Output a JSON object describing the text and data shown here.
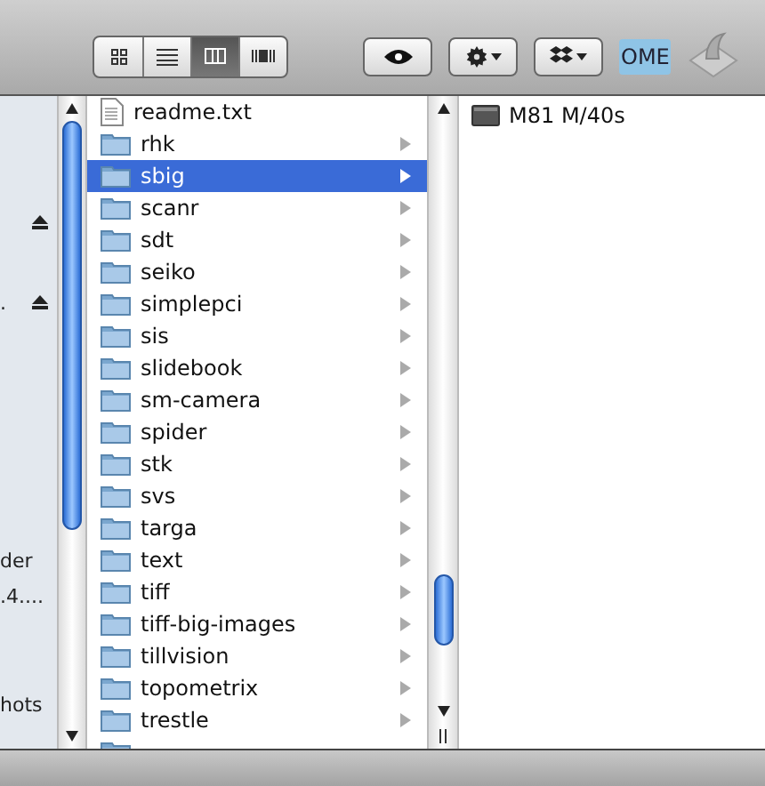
{
  "toolbar": {
    "view_modes": [
      {
        "kind": "icons",
        "selected": false
      },
      {
        "kind": "list",
        "selected": false
      },
      {
        "kind": "columns",
        "selected": true
      },
      {
        "kind": "coverflow",
        "selected": false
      }
    ],
    "buttons": [
      {
        "kind": "quicklook"
      },
      {
        "kind": "action"
      },
      {
        "kind": "dropbox"
      }
    ],
    "ome_label": "OME"
  },
  "sidebar": {
    "items": [
      {
        "eject": true
      },
      {
        "label": ".",
        "eject": true
      },
      {
        "label": "der",
        "eject": false
      },
      {
        "label": ".4....",
        "eject": false
      },
      {
        "label": "hots",
        "eject": false
      }
    ]
  },
  "columns": [
    {
      "items": [
        {
          "name": "readme.txt",
          "kind": "file",
          "selected": false
        },
        {
          "name": "rhk",
          "kind": "folder",
          "selected": false
        },
        {
          "name": "sbig",
          "kind": "folder",
          "selected": true
        },
        {
          "name": "scanr",
          "kind": "folder",
          "selected": false
        },
        {
          "name": "sdt",
          "kind": "folder",
          "selected": false
        },
        {
          "name": "seiko",
          "kind": "folder",
          "selected": false
        },
        {
          "name": "simplepci",
          "kind": "folder",
          "selected": false
        },
        {
          "name": "sis",
          "kind": "folder",
          "selected": false
        },
        {
          "name": "slidebook",
          "kind": "folder",
          "selected": false
        },
        {
          "name": "sm-camera",
          "kind": "folder",
          "selected": false
        },
        {
          "name": "spider",
          "kind": "folder",
          "selected": false
        },
        {
          "name": "stk",
          "kind": "folder",
          "selected": false
        },
        {
          "name": "svs",
          "kind": "folder",
          "selected": false
        },
        {
          "name": "targa",
          "kind": "folder",
          "selected": false
        },
        {
          "name": "text",
          "kind": "folder",
          "selected": false
        },
        {
          "name": "tiff",
          "kind": "folder",
          "selected": false
        },
        {
          "name": "tiff-big-images",
          "kind": "folder",
          "selected": false
        },
        {
          "name": "tillvision",
          "kind": "folder",
          "selected": false
        },
        {
          "name": "topometrix",
          "kind": "folder",
          "selected": false
        },
        {
          "name": "trestle",
          "kind": "folder",
          "selected": false
        }
      ]
    },
    {
      "items": [
        {
          "name": "M81 M/40s",
          "kind": "device",
          "selected": false
        }
      ]
    }
  ]
}
